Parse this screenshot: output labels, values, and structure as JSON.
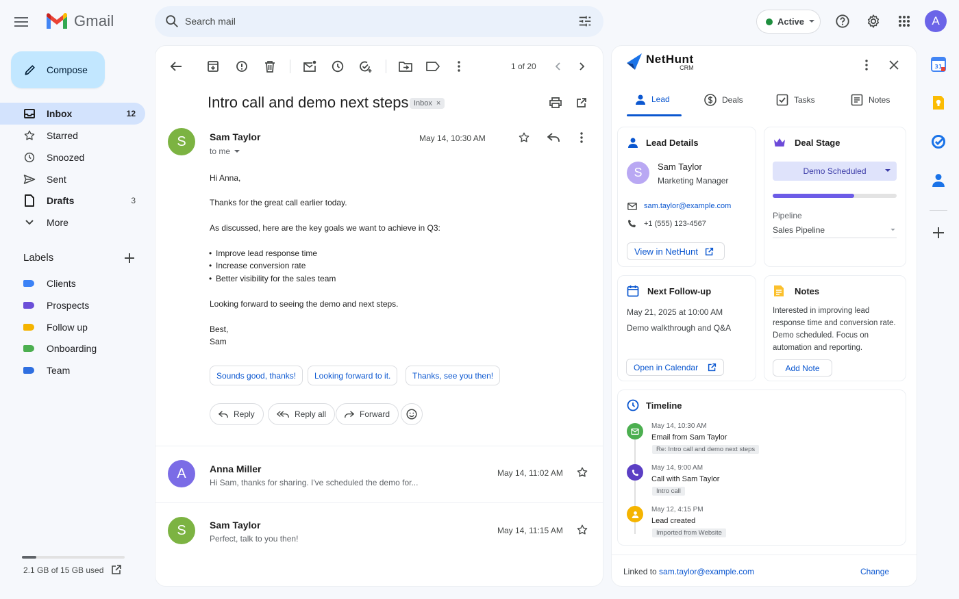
{
  "header": {
    "app_name": "Gmail",
    "search_placeholder": "Search mail",
    "status": "Active",
    "avatar_letter": "A"
  },
  "nav": {
    "compose": "Compose",
    "items": [
      {
        "label": "Inbox",
        "count": "12",
        "icon": "inbox-icon"
      },
      {
        "label": "Starred",
        "count": "",
        "icon": "star-icon"
      },
      {
        "label": "Snoozed",
        "count": "",
        "icon": "clock-icon"
      },
      {
        "label": "Sent",
        "count": "",
        "icon": "send-icon"
      },
      {
        "label": "Drafts",
        "count": "3",
        "icon": "draft-icon"
      },
      {
        "label": "More",
        "count": "",
        "icon": "chevron-down-icon"
      }
    ],
    "labels_heading": "Labels",
    "labels": [
      {
        "name": "Clients",
        "color": "#3b82f6"
      },
      {
        "name": "Prospects",
        "color": "#6b4fd8"
      },
      {
        "name": "Follow up",
        "color": "#f5b400"
      },
      {
        "name": "Onboarding",
        "color": "#4caf50"
      },
      {
        "name": "Team",
        "color": "#2f6fe0"
      }
    ],
    "storage_text": "2.1 GB of 15 GB used",
    "storage_fraction": 0.14
  },
  "mail": {
    "pager": "1 of 20",
    "subject": "Intro call and demo next steps",
    "subject_chip": "Inbox",
    "message": {
      "avatar": "S",
      "sender": "Sam Taylor",
      "to": "to me",
      "date": "May 14, 10:30 AM",
      "greeting": "Hi Anna,",
      "line1": "Thanks for the great call earlier today.",
      "line2": "As discussed, here are the key goals we want to achieve in Q3:",
      "bullets": [
        "Improve lead response time",
        "Increase conversion rate",
        "Better visibility for the sales team"
      ],
      "line3": "Looking forward to seeing the demo and next steps.",
      "signoff": "Best,",
      "signature": "Sam"
    },
    "smart_replies": [
      "Sounds good, thanks!",
      "Looking forward to it.",
      "Thanks, see you then!"
    ],
    "actions": {
      "reply": "Reply",
      "reply_all": "Reply all",
      "forward": "Forward"
    },
    "thread": [
      {
        "avatar": "A",
        "sender": "Anna Miller",
        "preview": "Hi Sam, thanks for sharing. I've scheduled the demo for...",
        "date": "May 14, 11:02 AM"
      },
      {
        "avatar": "S",
        "sender": "Sam Taylor",
        "preview": "Perfect, talk to you then!",
        "date": "May 14, 11:15 AM"
      }
    ]
  },
  "crm": {
    "brand": "NetHunt",
    "brand_sub": "CRM",
    "tabs": [
      "Lead",
      "Deals",
      "Tasks",
      "Notes"
    ],
    "lead": {
      "title": "Lead Details",
      "avatar": "S",
      "name": "Sam Taylor",
      "role": "Marketing Manager",
      "email": "sam.taylor@example.com",
      "phone": "+1 (555) 123-4567",
      "view_btn": "View in NetHunt"
    },
    "deal": {
      "title": "Deal Stage",
      "stage": "Demo Scheduled",
      "progress": 0.66,
      "pipeline_label": "Pipeline",
      "pipeline_value": "Sales Pipeline"
    },
    "followup": {
      "title": "Next Follow-up",
      "datetime": "May 21, 2025 at 10:00 AM",
      "desc": "Demo walkthrough and Q&A",
      "btn": "Open in Calendar"
    },
    "notes": {
      "title": "Notes",
      "lines": [
        "Interested in improving lead",
        "response time and conversion rate.",
        "Demo scheduled. Focus on",
        "automation and reporting."
      ],
      "btn": "Add Note"
    },
    "timeline": {
      "title": "Timeline",
      "events": [
        {
          "time": "May 14, 10:30 AM",
          "title": "Email from Sam Taylor",
          "tag": "Re: Intro call and demo next steps",
          "color": "#4caf50",
          "icon": "mail-icon"
        },
        {
          "time": "May 14, 9:00 AM",
          "title": "Call with Sam Taylor",
          "tag": "Intro call",
          "color": "#6b4fd8",
          "icon": "phone-icon"
        },
        {
          "time": "May 12, 4:15 PM",
          "title": "Lead created",
          "tag": "Imported from Website",
          "color": "#f5b400",
          "icon": "person-icon"
        }
      ]
    },
    "footer": {
      "prefix": "Linked to",
      "email": "sam.taylor@example.com",
      "change": "Change"
    }
  }
}
